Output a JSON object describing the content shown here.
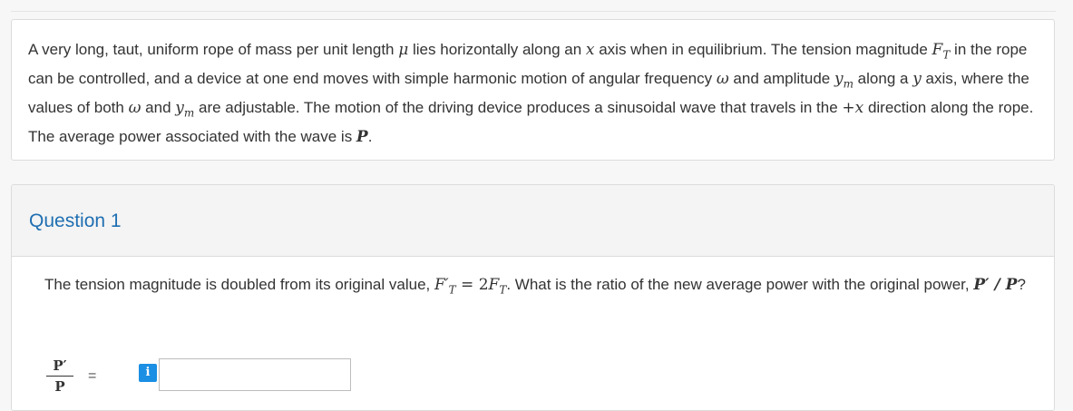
{
  "intro": {
    "t1": "A very long, taut, uniform rope of mass per unit length ",
    "mu": "μ",
    "t2": " lies horizontally along an ",
    "x1": "x",
    "t3": " axis when in equilibrium. The tension magnitude ",
    "F": "F",
    "T": "T",
    "t4": " in the rope can be controlled, and a device at one end moves with simple harmonic motion of angular frequency ",
    "omega1": "ω",
    "t5": " and amplitude ",
    "y1": "y",
    "m1": "m",
    "t6": " along a ",
    "y2": "y",
    "t7": " axis, where the values of both ",
    "omega2": "ω",
    "t8": " and ",
    "y3": "y",
    "m2": "m",
    "t9": " are adjustable. The motion of the driving device produces a sinusoidal wave that travels in the ",
    "plusx": "+x",
    "t10": " direction along the rope. The average power associated with the wave is ",
    "P": "P",
    "t11": "."
  },
  "question": {
    "title": "Question 1",
    "q1": "The tension magnitude is doubled from its original value, ",
    "FT_new": "F′",
    "FT_sub": "T",
    "eq": " = 2",
    "F2": "F",
    "F2_sub": "T",
    "q2": ". What is the ratio of the new average power with the original power, ",
    "ratio": "P′ / P",
    "q3": "?",
    "answer": {
      "numerator": "P′",
      "denominator": "P",
      "equals": "=",
      "info_icon_text": "i",
      "input_value": "",
      "input_placeholder": ""
    }
  }
}
